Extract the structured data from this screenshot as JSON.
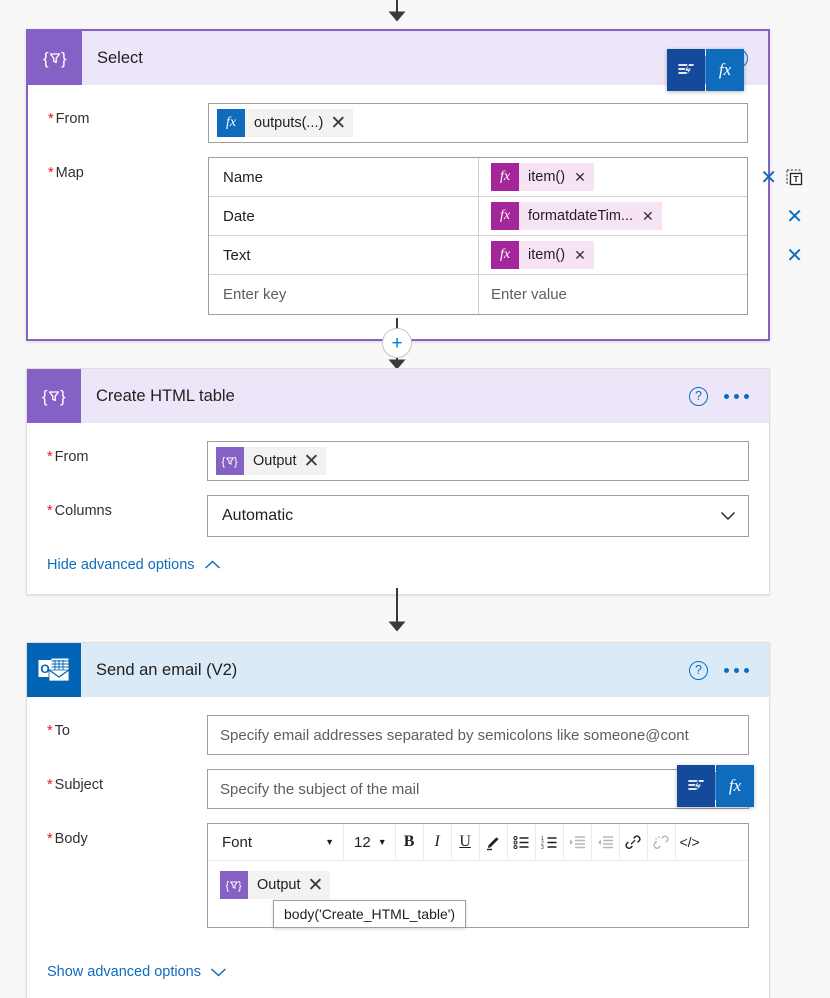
{
  "flow": {
    "cards": [
      {
        "id": "select",
        "title": "Select",
        "icon": "data-operations-icon",
        "selected": true,
        "fields": {
          "from_label": "From",
          "from_token": "outputs(...)",
          "map_label": "Map",
          "map_rows": [
            {
              "key": "Name",
              "value": "item()",
              "value_kind": "fx"
            },
            {
              "key": "Date",
              "value": "formatdateTim...",
              "value_kind": "fx"
            },
            {
              "key": "Text",
              "value": "item()",
              "value_kind": "fx"
            }
          ],
          "map_key_placeholder": "Enter key",
          "map_value_placeholder": "Enter value"
        },
        "flyout": {
          "dynamic_icon": "dynamic-content-icon",
          "fx_label": "fx"
        }
      },
      {
        "id": "create-html-table",
        "title": "Create HTML table",
        "icon": "data-operations-icon",
        "selected": false,
        "fields": {
          "from_label": "From",
          "from_token": "Output",
          "columns_label": "Columns",
          "columns_value": "Automatic"
        },
        "advanced_link": "Hide advanced options",
        "advanced_caret": "up"
      },
      {
        "id": "send-an-email-v2",
        "title": "Send an email (V2)",
        "icon": "outlook-icon",
        "selected": false,
        "fields": {
          "to_label": "To",
          "to_placeholder": "Specify email addresses separated by semicolons like someone@cont",
          "subject_label": "Subject",
          "subject_placeholder": "Specify the subject of the mail",
          "body_label": "Body",
          "body_token": "Output"
        },
        "editor_toolbar": {
          "font_name": "Font",
          "font_size": "12",
          "buttons": [
            {
              "name": "bold-button",
              "glyph": "B",
              "disabled": false
            },
            {
              "name": "italic-button",
              "glyph": "I",
              "disabled": false
            },
            {
              "name": "underline-button",
              "glyph": "U",
              "disabled": false
            },
            {
              "name": "text-highlight-button",
              "glyph": "highlighter-icon",
              "disabled": false
            },
            {
              "name": "bulleted-list-button",
              "glyph": "bulleted-list-icon",
              "disabled": false
            },
            {
              "name": "numbered-list-button",
              "glyph": "numbered-list-icon",
              "disabled": false
            },
            {
              "name": "increase-indent-button",
              "glyph": "indent-icon",
              "disabled": true
            },
            {
              "name": "decrease-indent-button",
              "glyph": "outdent-icon",
              "disabled": true
            },
            {
              "name": "insert-link-button",
              "glyph": "link-icon",
              "disabled": false
            },
            {
              "name": "remove-link-button",
              "glyph": "unlink-icon",
              "disabled": true
            },
            {
              "name": "code-view-button",
              "glyph": "</>",
              "disabled": false
            }
          ]
        },
        "tooltip": "body('Create_HTML_table')",
        "advanced_link": "Show advanced options",
        "advanced_caret": "down",
        "flyout": {
          "dynamic_icon": "dynamic-content-icon",
          "fx_label": "fx"
        }
      }
    ],
    "connectors": [
      {
        "id": "conn-top",
        "has_plus": false,
        "plus_label": ""
      },
      {
        "id": "conn-select-to-table",
        "has_plus": true,
        "plus_label": "+"
      },
      {
        "id": "conn-table-to-email",
        "has_plus": false,
        "plus_label": ""
      }
    ],
    "header_actions": {
      "help_label": "?",
      "more_label": "more-options"
    },
    "colors": {
      "accent_purple": "#8661c5",
      "header_purple": "#ece6f8",
      "header_blue": "#daeaf7",
      "outlook_blue": "#0264b4",
      "link_blue": "#0f6cbd",
      "required_red": "#e81123",
      "fx_magenta": "#a4269b",
      "fx_blue": "#0f6cbd",
      "token_pink": "#f6e4f4"
    }
  }
}
